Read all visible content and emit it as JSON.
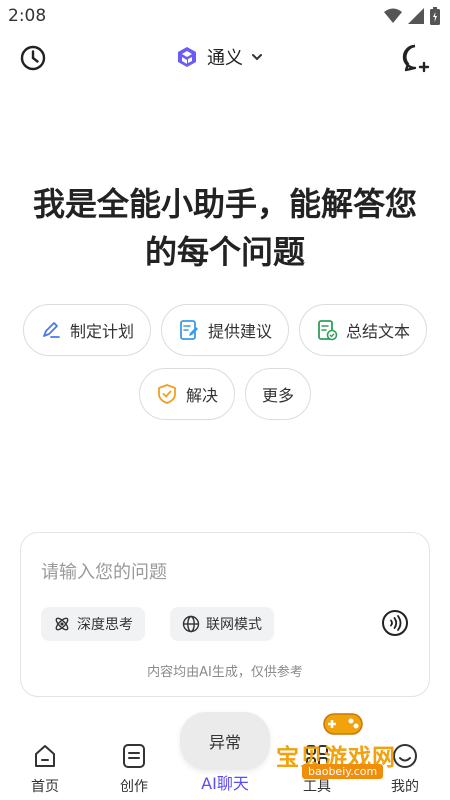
{
  "status": {
    "time": "2:08"
  },
  "header": {
    "model_name": "通义"
  },
  "hero": {
    "line1": "我是全能小助手，能解答您",
    "line2": "的每个问题"
  },
  "chips": {
    "plan": "制定计划",
    "suggest": "提供建议",
    "summary": "总结文本",
    "solve": "解决",
    "more": "更多"
  },
  "input": {
    "placeholder": "请输入您的问题",
    "deep_think": "深度思考",
    "web_mode": "联网模式",
    "disclaimer": "内容均由AI生成，仅供参考"
  },
  "toast": {
    "text": "异常"
  },
  "nav": {
    "home": "首页",
    "create": "创作",
    "chat": "AI聊天",
    "tools": "工具",
    "mine": "我的"
  },
  "watermark": {
    "text": "宝贝游戏网",
    "url": "baobeiy.com"
  },
  "colors": {
    "accent": "#5b4cf5",
    "text": "#222222",
    "border": "#dcdcdc"
  }
}
